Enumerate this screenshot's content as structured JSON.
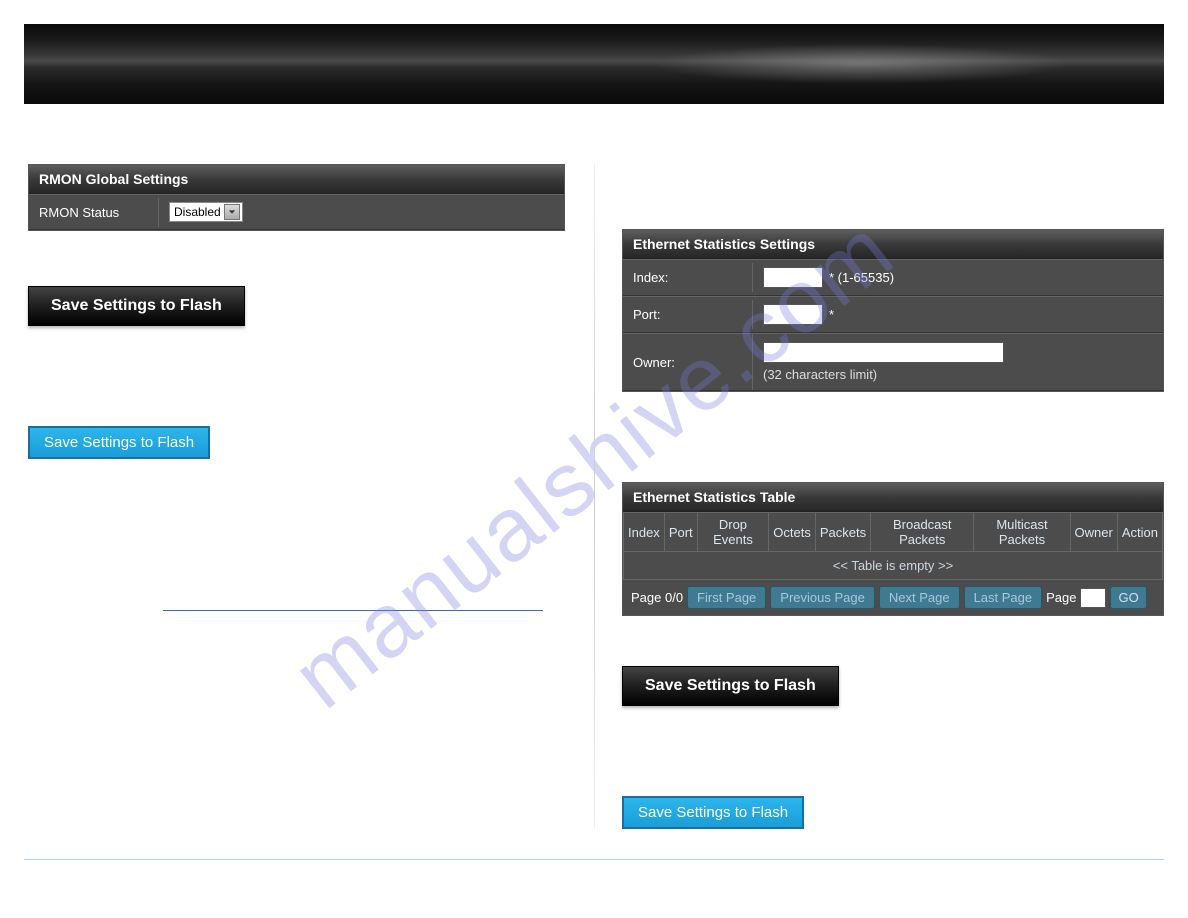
{
  "watermark": "manualshive.com",
  "left": {
    "rmon": {
      "header": "RMON Global Settings",
      "status_label": "RMON Status",
      "status_value": "Disabled"
    },
    "save_black": "Save Settings to Flash",
    "save_blue": "Save Settings to Flash"
  },
  "right": {
    "eth_settings": {
      "header": "Ethernet Statistics Settings",
      "index_label": "Index:",
      "index_hint": "* (1-65535)",
      "port_label": "Port:",
      "port_hint": "*",
      "owner_label": "Owner:",
      "owner_hint": "(32 characters limit)"
    },
    "eth_table": {
      "header": "Ethernet Statistics Table",
      "columns": {
        "index": "Index",
        "port": "Port",
        "drop_events": "Drop Events",
        "octets": "Octets",
        "packets": "Packets",
        "broadcast": "Broadcast Packets",
        "multicast": "Multicast Packets",
        "owner": "Owner",
        "action": "Action"
      },
      "empty": "<< Table is empty >>",
      "pager": {
        "page_label": "Page 0/0",
        "first": "First Page",
        "previous": "Previous Page",
        "next": "Next Page",
        "last": "Last Page",
        "page_word": "Page",
        "go": "GO"
      }
    },
    "save_black": "Save Settings to Flash",
    "save_blue": "Save Settings to Flash"
  }
}
